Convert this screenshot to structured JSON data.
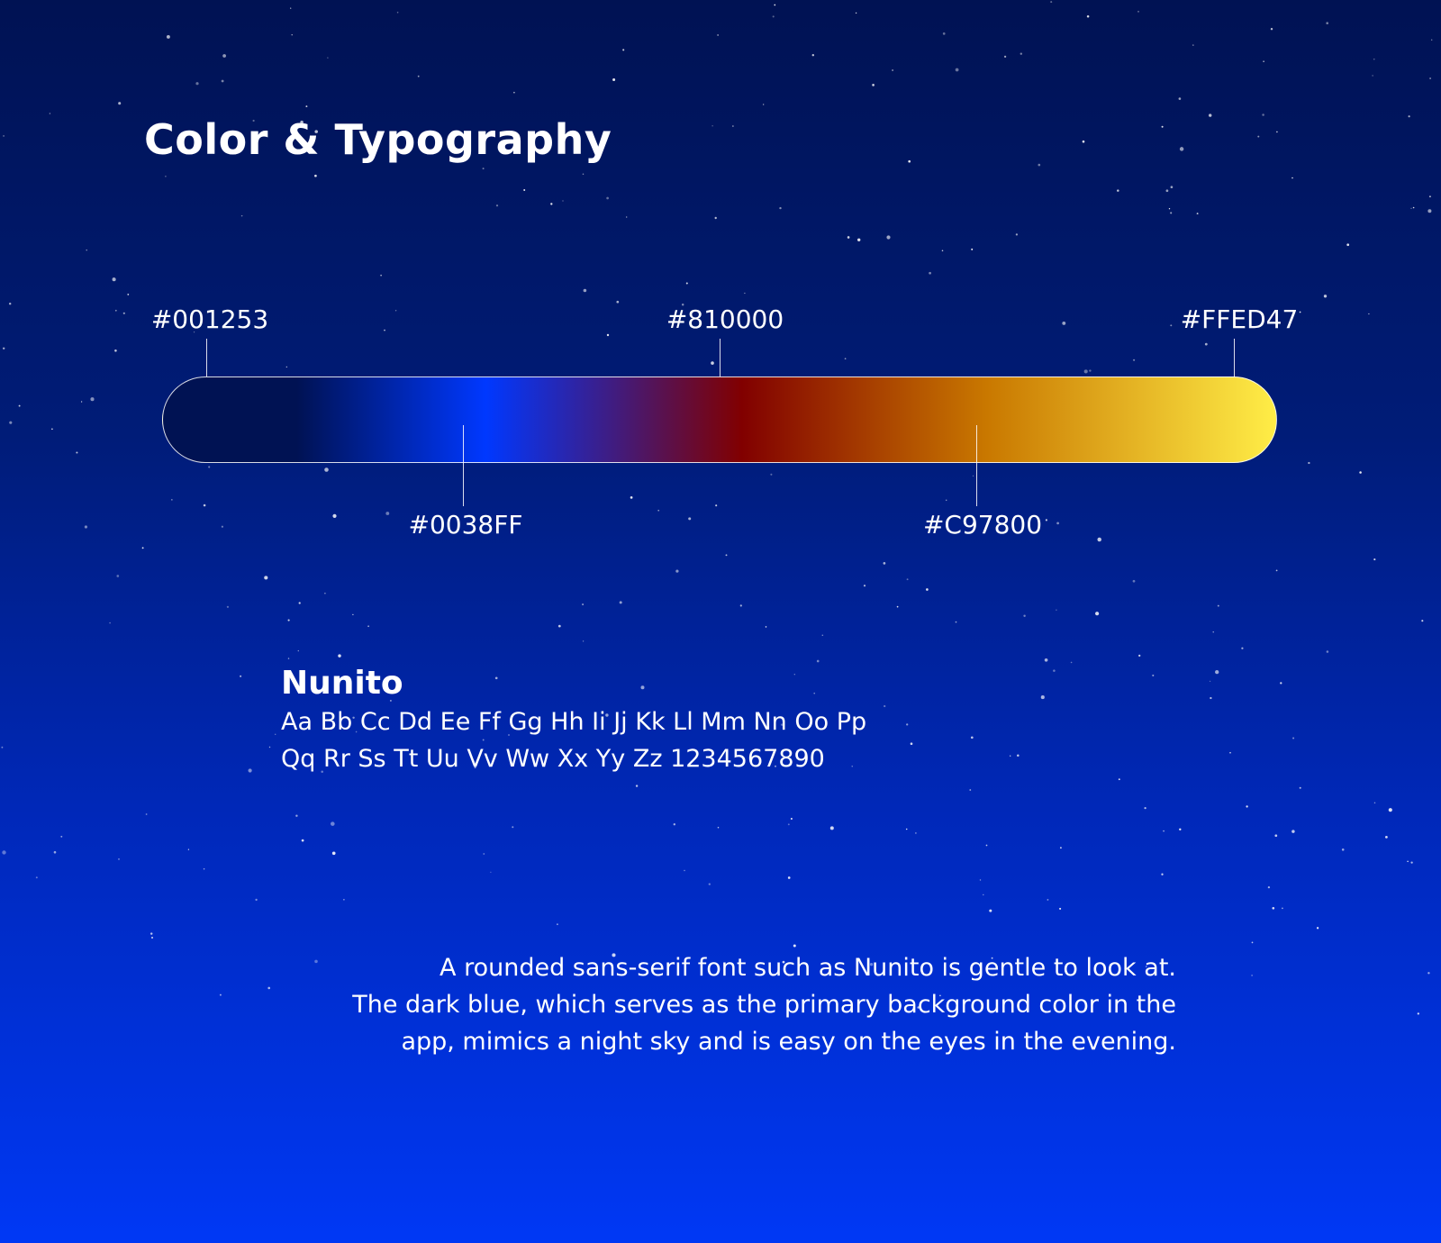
{
  "header": {
    "title": "Color & Typography"
  },
  "palette": {
    "gradient_stops": [
      "#001253",
      "#0038FF",
      "#810000",
      "#C97800",
      "#FFED47"
    ],
    "swatches": [
      {
        "label": "#001253",
        "color": "#001253"
      },
      {
        "label": "#0038FF",
        "color": "#0038FF"
      },
      {
        "label": "#810000",
        "color": "#810000"
      },
      {
        "label": "#C97800",
        "color": "#C97800"
      },
      {
        "label": "#FFED47",
        "color": "#FFED47"
      }
    ]
  },
  "typography": {
    "font_name": "Nunito",
    "alphabet_line1": "Aa Bb Cc Dd Ee Ff Gg Hh Ii Jj Kk Ll Mm Nn Oo Pp",
    "alphabet_line2": "Qq Rr Ss Tt Uu Vv Ww Xx Yy Zz 1234567890"
  },
  "description": {
    "line1": "A rounded sans-serif font such as Nunito is gentle to look at.",
    "line2": "The dark blue, which serves as the primary background color in the",
    "line3": "app, mimics a night sky and is easy on the eyes in the evening."
  }
}
